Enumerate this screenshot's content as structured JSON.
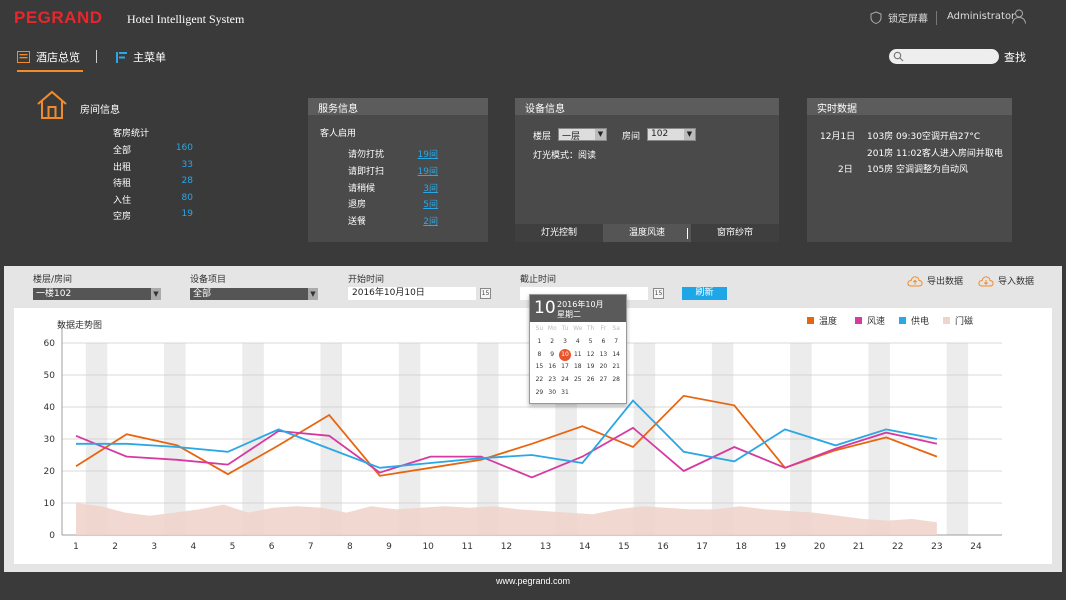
{
  "header": {
    "logo": "PEGRAND",
    "system_name": "Hotel Intelligent System",
    "lock_label": "锁定屏幕",
    "user": "Administrator"
  },
  "nav": {
    "overview": "酒店总览",
    "main_menu": "主菜单",
    "search_placeholder": "",
    "search_button": "查找"
  },
  "room_info": {
    "title": "房间信息",
    "subtitle": "客房统计",
    "rows": [
      {
        "label": "全部",
        "value": "160"
      },
      {
        "label": "出租",
        "value": "33"
      },
      {
        "label": "待租",
        "value": "28"
      },
      {
        "label": "入住",
        "value": "80"
      },
      {
        "label": "空房",
        "value": "19"
      }
    ]
  },
  "service_info": {
    "title": "服务信息",
    "subtitle": "客人启用",
    "rows": [
      {
        "label": "请勿打扰",
        "value": "19间"
      },
      {
        "label": "请即打扫",
        "value": "19间"
      },
      {
        "label": "请稍候",
        "value": "3间"
      },
      {
        "label": "退房",
        "value": "5间"
      },
      {
        "label": "送餐",
        "value": "2间"
      }
    ]
  },
  "device_info": {
    "title": "设备信息",
    "floor_label": "楼层",
    "floor_value": "一层",
    "room_label": "房间",
    "room_value": "102",
    "light_mode": "灯光模式：阅读",
    "tabs": [
      "灯光控制",
      "温度风速",
      "窗帘纱帘"
    ],
    "active_tab": 1
  },
  "realtime": {
    "title": "实时数据",
    "entries": [
      {
        "date": "12月1日",
        "room": "103房",
        "text": "09:30空调开启27°C"
      },
      {
        "date": "",
        "room": "201房",
        "text": "11:02客人进入房间并取电"
      },
      {
        "date": "2日",
        "room": "105房",
        "text": "空调调整为自动风"
      }
    ]
  },
  "filters": {
    "floor_room_label": "楼层/房间",
    "floor_room_value": "一楼102",
    "device_label": "设备项目",
    "device_value": "全部",
    "start_label": "开始时间",
    "start_value": "2016年10月10日",
    "end_label": "截止时间",
    "end_value": "",
    "refresh": "刷新",
    "export": "导出数据",
    "import": "导入数据"
  },
  "calendar": {
    "day": "10",
    "month": "2016年10月",
    "weekday": "星期二",
    "weekdays": [
      "Su",
      "Mo",
      "Tu",
      "We",
      "Th",
      "Fr",
      "Sa"
    ],
    "days": [
      "",
      "",
      "",
      "",
      "",
      "",
      "",
      "1",
      "2",
      "3",
      "4",
      "5",
      "6",
      "7",
      "8",
      "9",
      "10",
      "11",
      "12",
      "13",
      "14",
      "15",
      "16",
      "17",
      "18",
      "19",
      "20",
      "21",
      "22",
      "23",
      "24",
      "25",
      "26",
      "27",
      "28",
      "29",
      "30",
      "31",
      "",
      "",
      "",
      ""
    ],
    "selected": "10"
  },
  "colors": {
    "temp": "#e8650f",
    "wind": "#d63aa0",
    "power": "#2aa7e5",
    "door": "#f0d4cc",
    "accent_blue": "#2aa7e5",
    "accent_orange": "#f28c28"
  },
  "chart_data": {
    "type": "line",
    "title": "数据走势图",
    "x": [
      1,
      2,
      3,
      4,
      5,
      6,
      7,
      8,
      9,
      10,
      11,
      12,
      13,
      14,
      15,
      16,
      17,
      18,
      19,
      20,
      21,
      22,
      23,
      24
    ],
    "ylim": [
      0,
      60
    ],
    "yticks": [
      0,
      10,
      20,
      30,
      40,
      50,
      60
    ],
    "legend_position": "top-right",
    "grid": true,
    "series": [
      {
        "name": "温度",
        "key": "temp",
        "type": "line",
        "values": [
          21.5,
          31.5,
          28,
          19,
          28,
          37.5,
          18.5,
          21,
          23.5,
          28.5,
          34,
          27.5,
          43.5,
          40.5,
          21,
          26.5,
          30.5,
          24.5
        ]
      },
      {
        "name": "风速",
        "key": "wind",
        "type": "line",
        "values": [
          31,
          24.5,
          23.5,
          22,
          32.5,
          31,
          19.5,
          24.5,
          24.5,
          18,
          24.5,
          33.5,
          20,
          27.5,
          21,
          27,
          32,
          28.5
        ]
      },
      {
        "name": "供电",
        "key": "power",
        "type": "line",
        "values": [
          28.5,
          28.5,
          27.5,
          26,
          33,
          27,
          21,
          22.5,
          24,
          25,
          22.5,
          42,
          26,
          23,
          33,
          28,
          33,
          30
        ]
      },
      {
        "name": "门磁",
        "key": "door",
        "type": "area",
        "values": [
          10,
          9,
          7,
          6,
          7,
          8,
          9.5,
          7,
          8.5,
          9,
          8.5,
          7,
          9,
          8,
          8.5,
          9,
          8.5,
          9,
          8,
          7.5,
          7,
          6.5,
          8,
          9,
          8.5,
          8,
          8,
          9,
          8,
          7.5,
          7,
          6,
          5,
          4.5,
          5,
          4
        ]
      }
    ]
  },
  "footer": "www.pegrand.com"
}
